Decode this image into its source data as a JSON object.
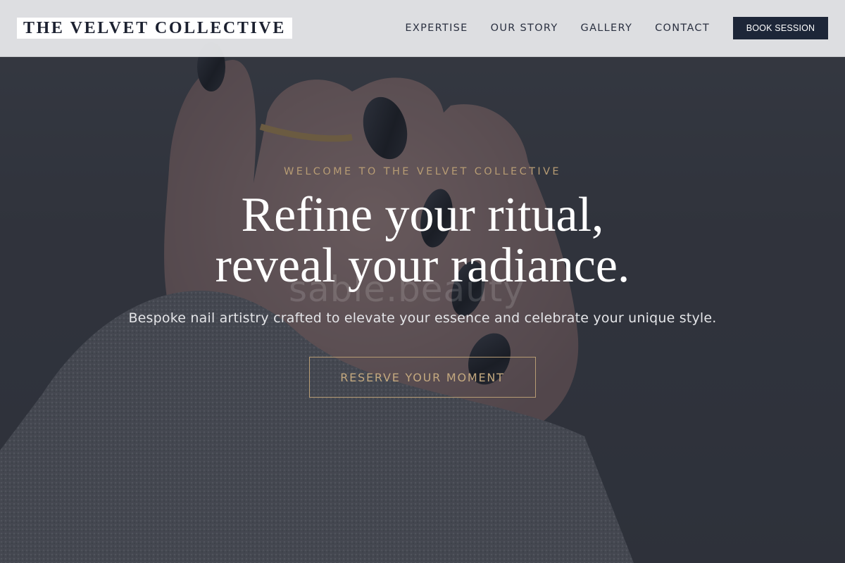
{
  "brand": {
    "name": "THE VELVET COLLECTIVE"
  },
  "nav": {
    "items": [
      {
        "label": "EXPERTISE"
      },
      {
        "label": "OUR STORY"
      },
      {
        "label": "GALLERY"
      },
      {
        "label": "CONTACT"
      }
    ],
    "book_label": "BOOK SESSION"
  },
  "hero": {
    "eyebrow": "WELCOME TO THE VELVET COLLECTIVE",
    "headline_line1": "Refine your ritual,",
    "headline_line2": "reveal your radiance.",
    "subtext": "Bespoke nail artistry crafted to elevate your essence and celebrate your unique style.",
    "cta_label": "RESERVE YOUR MOMENT",
    "watermark": "sable.beauty"
  },
  "colors": {
    "accent_gold": "#b79c74",
    "navy": "#1d2638",
    "header_bg": "#e8e9eb"
  }
}
